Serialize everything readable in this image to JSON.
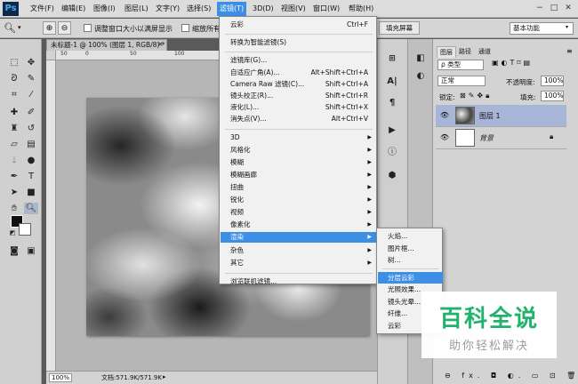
{
  "menubar": {
    "logo": "Ps",
    "items": [
      "文件(F)",
      "编辑(E)",
      "图像(I)",
      "图层(L)",
      "文字(Y)",
      "选择(S)",
      "滤镜(T)",
      "3D(D)",
      "视图(V)",
      "窗口(W)",
      "帮助(H)"
    ],
    "active": "滤镜(T)"
  },
  "optbar": {
    "resize_checkbox": "调整窗口大小以满屏显示",
    "zoom_all_checkbox": "缩放所有",
    "fill_screen": "填充屏幕",
    "workspace": "基本功能"
  },
  "document": {
    "tab": "未标题-1 @ 100% (图层 1, RGB/8) *",
    "zoom": "100%",
    "doc_size": "文档:571.9K/571.9K",
    "ruler_ticks": [
      "50",
      "0",
      "50",
      "100",
      "150",
      "200",
      "250"
    ]
  },
  "filter_menu": {
    "items": [
      {
        "label": "云彩",
        "shortcut": "Ctrl+F"
      },
      {
        "sep": true
      },
      {
        "label": "转换为智能滤镜(S)"
      },
      {
        "sep": true
      },
      {
        "label": "滤镜库(G)..."
      },
      {
        "label": "自适应广角(A)...",
        "shortcut": "Alt+Shift+Ctrl+A"
      },
      {
        "label": "Camera Raw 滤镜(C)...",
        "shortcut": "Shift+Ctrl+A"
      },
      {
        "label": "镜头校正(R)...",
        "shortcut": "Shift+Ctrl+R"
      },
      {
        "label": "液化(L)...",
        "shortcut": "Shift+Ctrl+X"
      },
      {
        "label": "消失点(V)...",
        "shortcut": "Alt+Ctrl+V"
      },
      {
        "sep": true
      },
      {
        "label": "3D",
        "sub": true
      },
      {
        "label": "风格化",
        "sub": true
      },
      {
        "label": "模糊",
        "sub": true
      },
      {
        "label": "模糊画廊",
        "sub": true
      },
      {
        "label": "扭曲",
        "sub": true
      },
      {
        "label": "锐化",
        "sub": true
      },
      {
        "label": "视频",
        "sub": true
      },
      {
        "label": "像素化",
        "sub": true
      },
      {
        "label": "渲染",
        "sub": true,
        "hl": true
      },
      {
        "label": "杂色",
        "sub": true
      },
      {
        "label": "其它",
        "sub": true
      },
      {
        "sep": true
      },
      {
        "label": "浏览联机滤镜..."
      }
    ]
  },
  "render_menu": {
    "items": [
      {
        "label": "火焰..."
      },
      {
        "label": "图片框..."
      },
      {
        "label": "树..."
      },
      {
        "sep": true
      },
      {
        "label": "分层云彩",
        "hl": true
      },
      {
        "label": "光照效果..."
      },
      {
        "label": "镜头光晕..."
      },
      {
        "label": "纤维..."
      },
      {
        "label": "云彩"
      }
    ]
  },
  "layers_panel": {
    "tabs": [
      "图层",
      "路径",
      "通道"
    ],
    "kind": "ρ 类型",
    "blend_mode": "正常",
    "opacity_label": "不透明度:",
    "opacity": "100%",
    "lock_label": "锁定:",
    "fill_label": "填充:",
    "fill": "100%",
    "layers": [
      {
        "name": "图层 1",
        "selected": true
      },
      {
        "name": "背景",
        "locked": true
      }
    ],
    "footer_icons": "⊖ fx. ◘ ◐. ▭ ⊡ 🗑"
  },
  "watermark": {
    "title": "百科全说",
    "subtitle": "助你轻松解决"
  },
  "colors": {
    "menu_highlight": "#3d8fe6",
    "watermark_green": "#21b26b"
  }
}
